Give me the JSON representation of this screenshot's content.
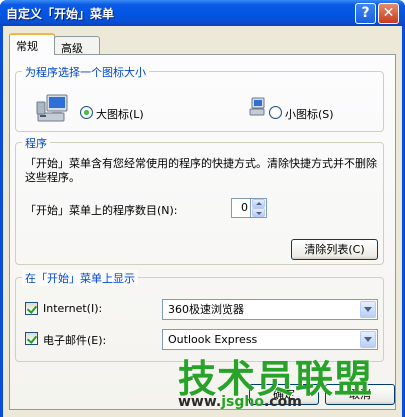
{
  "window": {
    "title": "自定义「开始」菜单",
    "help_label": "?",
    "close_label": "✕"
  },
  "tabs": [
    {
      "label": "常规",
      "selected": true
    },
    {
      "label": "高级",
      "selected": false
    }
  ],
  "icon_size_group": {
    "legend": "为程序选择一个图标大小",
    "large_label": "大图标(L)",
    "small_label": "小图标(S)",
    "selected": "large",
    "large_icon": "large-computer-icon",
    "small_icon": "small-computer-icon"
  },
  "programs_group": {
    "legend": "程序",
    "description": "「开始」菜单含有您经常使用的程序的快捷方式。清除快捷方式并不删除这些程序。",
    "count_label": "「开始」菜单上的程序数目(N):",
    "count_value": "0",
    "clear_button": "清除列表(C)"
  },
  "show_group": {
    "legend": "在「开始」菜单上显示",
    "internet_label": "Internet(I):",
    "internet_checked": true,
    "internet_value": "360极速浏览器",
    "email_label": "电子邮件(E):",
    "email_checked": true,
    "email_value": "Outlook Express"
  },
  "buttons": {
    "ok": "确定",
    "cancel": "取消"
  },
  "watermark": {
    "text": "技术员联盟",
    "url_prefix": "www.",
    "url_accent": "jsgho",
    "url_suffix": ".com"
  },
  "colors": {
    "title_bar": "#0255e3",
    "group_legend": "#0046d5",
    "watermark_green": "#27a327"
  }
}
